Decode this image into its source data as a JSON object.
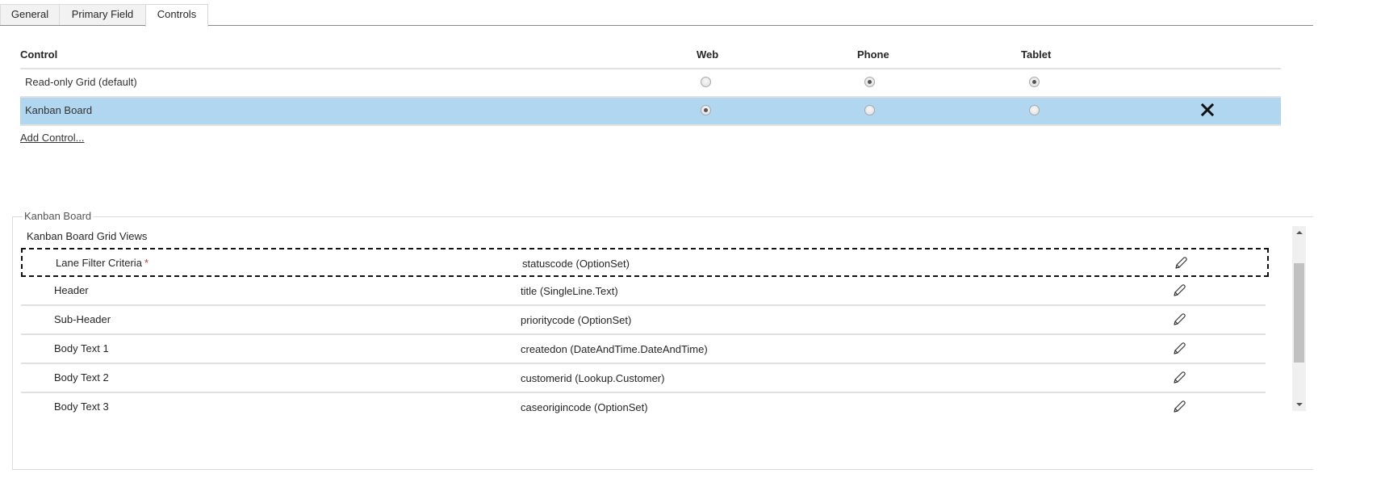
{
  "tabs": [
    {
      "label": "General",
      "active": false
    },
    {
      "label": "Primary Field",
      "active": false
    },
    {
      "label": "Controls",
      "active": true
    }
  ],
  "controls_grid": {
    "headers": {
      "control": "Control",
      "web": "Web",
      "phone": "Phone",
      "tablet": "Tablet"
    },
    "rows": [
      {
        "label": "Read-only Grid (default)",
        "web": false,
        "phone": true,
        "tablet": true,
        "selected": false,
        "removable": false
      },
      {
        "label": "Kanban Board",
        "web": true,
        "phone": false,
        "tablet": false,
        "selected": true,
        "removable": true,
        "remove_icon": "close-x-icon"
      }
    ],
    "add_control_label": "Add Control..."
  },
  "properties_panel": {
    "legend": "Kanban Board",
    "section_title": "Kanban Board Grid Views",
    "required_marker": "*",
    "edit_icon": "pencil-icon",
    "rows": [
      {
        "name": "Lane Filter Criteria",
        "required": true,
        "value": "statuscode (OptionSet)",
        "focused": true
      },
      {
        "name": "Header",
        "required": false,
        "value": "title (SingleLine.Text)",
        "focused": false
      },
      {
        "name": "Sub-Header",
        "required": false,
        "value": "prioritycode (OptionSet)",
        "focused": false
      },
      {
        "name": "Body Text 1",
        "required": false,
        "value": "createdon (DateAndTime.DateAndTime)",
        "focused": false
      },
      {
        "name": "Body Text 2",
        "required": false,
        "value": "customerid (Lookup.Customer)",
        "focused": false
      },
      {
        "name": "Body Text 3",
        "required": false,
        "value": "caseorigincode (OptionSet)",
        "focused": false
      }
    ]
  },
  "colors": {
    "selected_row": "#b1d6f0",
    "required": "#c0392b",
    "scroll_thumb": "#c1c1c1"
  }
}
